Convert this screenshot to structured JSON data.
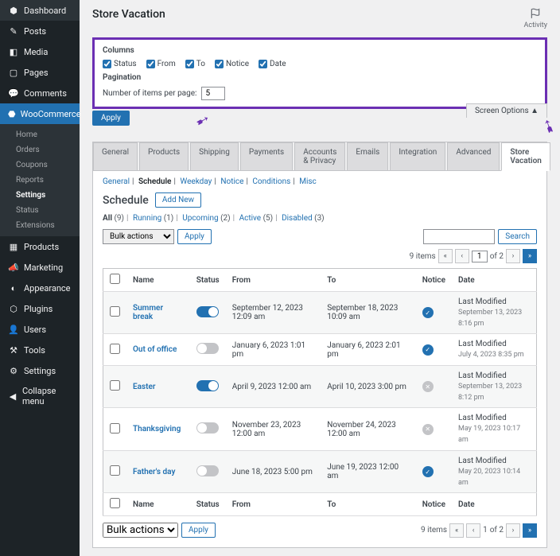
{
  "header": {
    "title": "Store Vacation",
    "activity": "Activity"
  },
  "sidebar": {
    "items": [
      {
        "icon": "⬢",
        "label": "Dashboard"
      },
      {
        "icon": "✎",
        "label": "Posts"
      },
      {
        "icon": "◧",
        "label": "Media"
      },
      {
        "icon": "▢",
        "label": "Pages"
      },
      {
        "icon": "💬",
        "label": "Comments"
      }
    ],
    "woo": {
      "icon": "⬣",
      "label": "WooCommerce"
    },
    "woosubs": [
      "Home",
      "Orders",
      "Coupons",
      "Reports",
      "Settings",
      "Status",
      "Extensions"
    ],
    "items2": [
      {
        "icon": "▦",
        "label": "Products"
      },
      {
        "icon": "📣",
        "label": "Marketing"
      },
      {
        "icon": "◐",
        "label": "Appearance"
      },
      {
        "icon": "⬡",
        "label": "Plugins"
      },
      {
        "icon": "👤",
        "label": "Users"
      },
      {
        "icon": "⚒",
        "label": "Tools"
      },
      {
        "icon": "⚙",
        "label": "Settings"
      }
    ],
    "collapse": "Collapse menu"
  },
  "screenopts": {
    "columns_h": "Columns",
    "cols": [
      "Status",
      "From",
      "To",
      "Notice",
      "Date"
    ],
    "pagination_h": "Pagination",
    "items_label": "Number of items per page:",
    "items_val": "5",
    "apply": "Apply",
    "tab": "Screen Options ▲"
  },
  "tabs": [
    "General",
    "Products",
    "Shipping",
    "Payments",
    "Accounts & Privacy",
    "Emails",
    "Integration",
    "Advanced",
    "Store Vacation"
  ],
  "subtabs": [
    "General",
    "Schedule",
    "Weekday",
    "Notice",
    "Conditions",
    "Misc"
  ],
  "schedule": {
    "title": "Schedule",
    "add": "Add New"
  },
  "filters": {
    "all": "All",
    "all_n": "(9)",
    "running": "Running",
    "running_n": "(1)",
    "upcoming": "Upcoming",
    "upcoming_n": "(2)",
    "active": "Active",
    "active_n": "(5)",
    "disabled": "Disabled",
    "disabled_n": "(3)"
  },
  "bulk": "Bulk actions",
  "apply": "Apply",
  "search": "Search",
  "pager": {
    "items": "9 items",
    "page": "1",
    "of": "of 2"
  },
  "cols": {
    "name": "Name",
    "status": "Status",
    "from": "From",
    "to": "To",
    "notice": "Notice",
    "date": "Date"
  },
  "rows": [
    {
      "name": "Summer break",
      "status": true,
      "from": "September 12, 2023 12:09 am",
      "to": "September 18, 2023 10:09 am",
      "notice": true,
      "d1": "Last Modified",
      "d2": "September 13, 2023 8:16 pm"
    },
    {
      "name": "Out of office",
      "status": false,
      "from": "January 6, 2023 1:01 pm",
      "to": "January 6, 2023 2:01 pm",
      "notice": true,
      "d1": "Last Modified",
      "d2": "July 4, 2023 8:35 pm"
    },
    {
      "name": "Easter",
      "status": true,
      "from": "April 9, 2023 12:00 am",
      "to": "April 10, 2023 3:00 pm",
      "notice": false,
      "d1": "Last Modified",
      "d2": "September 13, 2023 8:12 pm"
    },
    {
      "name": "Thanksgiving",
      "status": false,
      "from": "November 23, 2023 12:00 am",
      "to": "November 24, 2023 12:00 am",
      "notice": false,
      "d1": "Last Modified",
      "d2": "May 19, 2023 10:17 am"
    },
    {
      "name": "Father's day",
      "status": false,
      "from": "June 18, 2023 5:00 pm",
      "to": "June 19, 2023 12:00 am",
      "notice": true,
      "d1": "Last Modified",
      "d2": "May 20, 2023 10:14 am"
    }
  ]
}
